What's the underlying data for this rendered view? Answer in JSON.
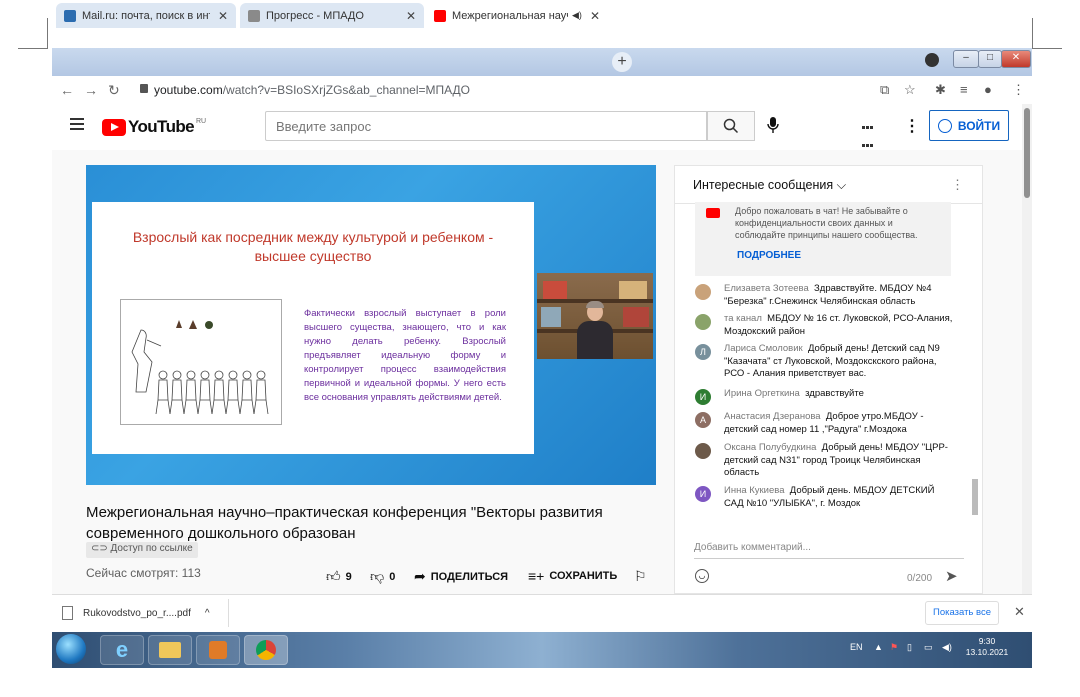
{
  "browser": {
    "tabs": [
      {
        "label": "Mail.ru: почта, поиск в интерне",
        "icon": "mailru-icon",
        "color": "#2b6cb0"
      },
      {
        "label": "Прогресс - МПАДО",
        "icon": "progress-icon",
        "color": "#555555"
      },
      {
        "label": "Межрегиональная научно-",
        "icon": "youtube-icon",
        "color": "#ff0000"
      }
    ],
    "url_host": "youtube.com",
    "url_path": "/watch?v=BSIoSXrjZGs&ab_channel=МПАДО"
  },
  "youtube": {
    "logo_text": "YouTube",
    "logo_region": "RU",
    "search_placeholder": "Введите запрос",
    "signin_label": "ВОЙТИ"
  },
  "slide": {
    "title": "Взрослый как посредник между культурой и ребенком - высшее существо",
    "body": "Фактически взрослый выступает в роли высшего существа, знающего, что и как нужно делать ребенку. Взрослый предъявляет идеальную форму и контролирует процесс взаимодействия первичной и идеальной формы. У него есть все основания управлять действиями детей."
  },
  "video": {
    "title": "Межрегиональная научно–практическая конференция \"Векторы развития современного дошкольного образован",
    "access_badge": "Доступ по ссылке",
    "viewers": "Сейчас смотрят: 113",
    "likes": "9",
    "dislikes": "0",
    "share_label": "ПОДЕЛИТЬСЯ",
    "save_label": "СОХРАНИТЬ"
  },
  "chat": {
    "header": "Интересные сообщения",
    "welcome_text": "Добро пожаловать в чат! Не забывайте о конфиденциальности своих данных и соблюдайте принципы нашего сообщества.",
    "welcome_link": "ПОДРОБНЕЕ",
    "messages": [
      {
        "author": "Елизавета Зотеева",
        "text": "Здравствуйте. МБДОУ №4 \"Березка\" г.Снежинск Челябинская область",
        "initial": "",
        "color": "#c9a27a"
      },
      {
        "author": "та канал",
        "text": "МБДОУ № 16 ст. Луковской, РСО-Алания, Моздокский район",
        "initial": "",
        "color": "#8aa36a"
      },
      {
        "author": "Лариса Смоловик",
        "text": "Добрый день! Детский сад N9 \"Казачата\" ст Луковской, Моздокскского района, РСО - Алания приветствует вас.",
        "initial": "Л",
        "color": "#78909c"
      },
      {
        "author": "Ирина Оргеткина",
        "text": "здравствуйте",
        "initial": "И",
        "color": "#2e7d32"
      },
      {
        "author": "Анастасия Дзеранова",
        "text": "Доброе утро.МБДОУ - детский сад номер 11 ,\"Радуга\" г.Моздока",
        "initial": "А",
        "color": "#8d6e63"
      },
      {
        "author": "Оксана Полубудкина",
        "text": "Добрый день! МБДОУ \"ЦРР-детский сад N31\" город Троицк Челябинская область",
        "initial": "",
        "color": "#6d5a4a"
      },
      {
        "author": "Инна Кукиева",
        "text": "Добрый день. МБДОУ ДЕТСКИЙ САД №10 \"УЛЫБКА\", г. Моздок",
        "initial": "И",
        "color": "#7e57c2"
      }
    ],
    "input_placeholder": "Добавить комментарий...",
    "counter": "0/200"
  },
  "downloads": {
    "file_name": "Rukovodstvo_po_r....pdf",
    "show_all": "Показать все"
  },
  "taskbar": {
    "lang": "EN",
    "time": "9:30",
    "date": "13.10.2021"
  }
}
